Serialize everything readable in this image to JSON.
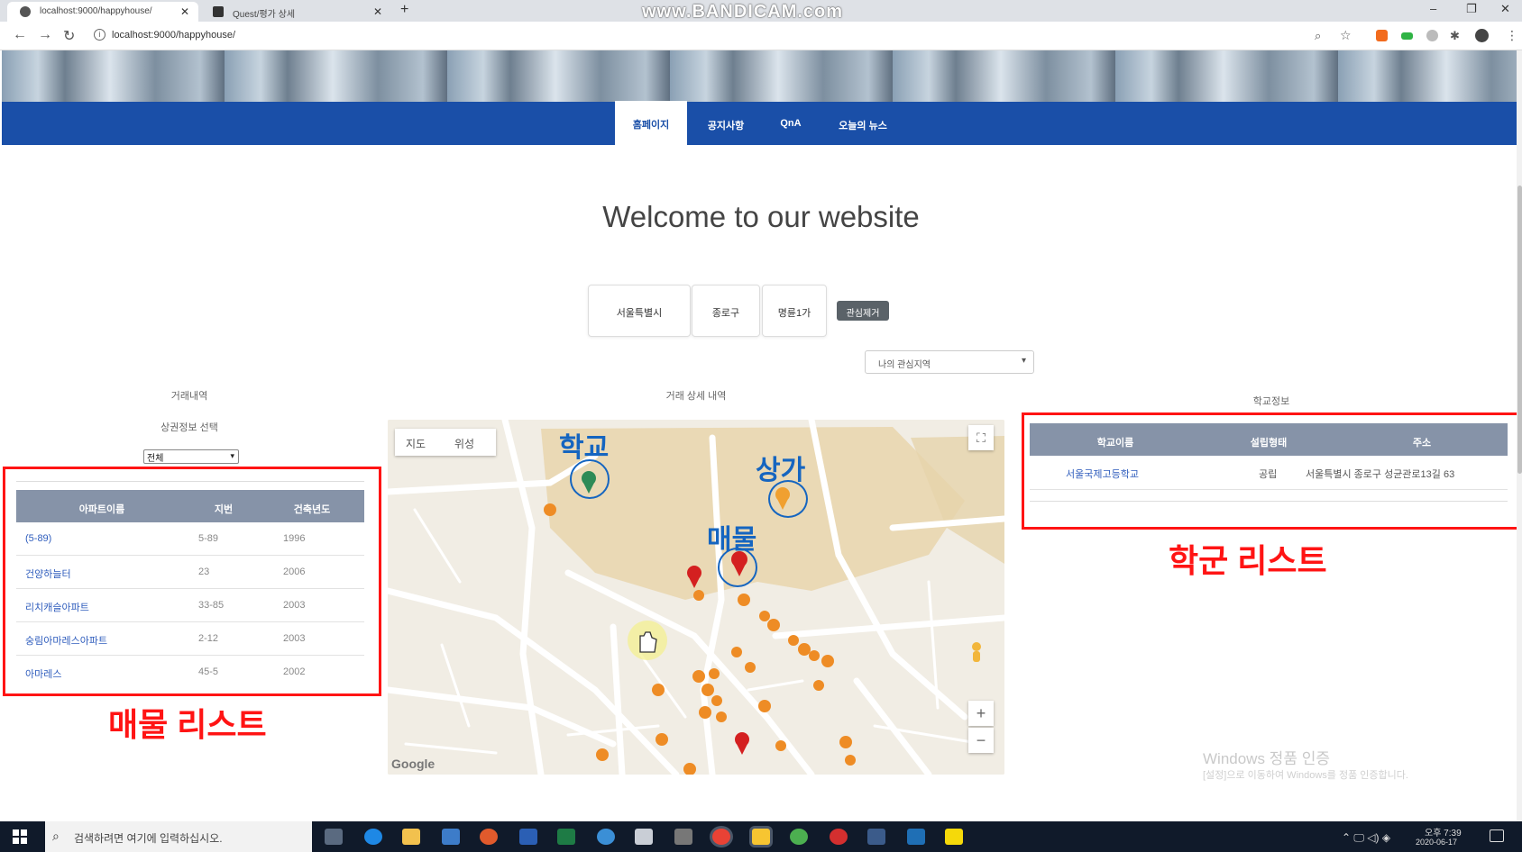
{
  "browser": {
    "tabs": [
      {
        "title": "localhost:9000/happyhouse/",
        "active": true
      },
      {
        "title": "Quest/평가 상세",
        "active": false
      }
    ],
    "watermark": "www.BANDICAM.com",
    "url": "localhost:9000/happyhouse/"
  },
  "nav": {
    "items": [
      "홈페이지",
      "공지사항",
      "QnA",
      "오늘의 뉴스"
    ],
    "active_index": 0
  },
  "hero": {
    "title": "Welcome to our website"
  },
  "region": {
    "city": "서울특별시",
    "district": "종로구",
    "dong": "명륜1가",
    "remove_button": "관심제거",
    "interest_select": "나의 관심지역"
  },
  "left_panel": {
    "title": "거래내역",
    "subtitle": "상권정보 선택",
    "select_value": "전체",
    "columns": [
      "아파트이름",
      "지번",
      "건축년도"
    ],
    "rows": [
      {
        "name": "(5-89)",
        "jibun": "5-89",
        "year": "1996"
      },
      {
        "name": "건양하늘터",
        "jibun": "23",
        "year": "2006"
      },
      {
        "name": "리치캐슬아파트",
        "jibun": "33-85",
        "year": "2003"
      },
      {
        "name": "숭림아마레스아파트",
        "jibun": "2-12",
        "year": "2003"
      },
      {
        "name": "아마레스",
        "jibun": "45-5",
        "year": "2002"
      }
    ]
  },
  "center_panel": {
    "title": "거래 상세 내역",
    "map_types": [
      "지도",
      "위성"
    ],
    "google": "Google",
    "zoom_in": "+",
    "zoom_out": "−"
  },
  "right_panel": {
    "title": "학교정보",
    "columns": [
      "학교이름",
      "설립형태",
      "주소"
    ],
    "rows": [
      {
        "name": "서울국제고등학교",
        "type": "공립",
        "address": "서울특별시 종로구 성균관로13길 63"
      }
    ]
  },
  "annotations": {
    "school": "학교",
    "store": "상가",
    "property": "매물",
    "property_list": "매물 리스트",
    "school_list": "학군 리스트",
    "color_red": "#ff1414",
    "color_blue": "#1565c0"
  },
  "windows_watermark": {
    "line1": "Windows 정품 인증",
    "line2": "[설정]으로 이동하여 Windows를 정품 인증합니다."
  },
  "taskbar": {
    "search_placeholder": "검색하려면 여기에 입력하십시오.",
    "time": "오후 7:39",
    "date": "2020-06-17"
  },
  "colors": {
    "navbar": "#1a4fa8",
    "table_header": "#8693a8",
    "link": "#2f5dbd"
  }
}
